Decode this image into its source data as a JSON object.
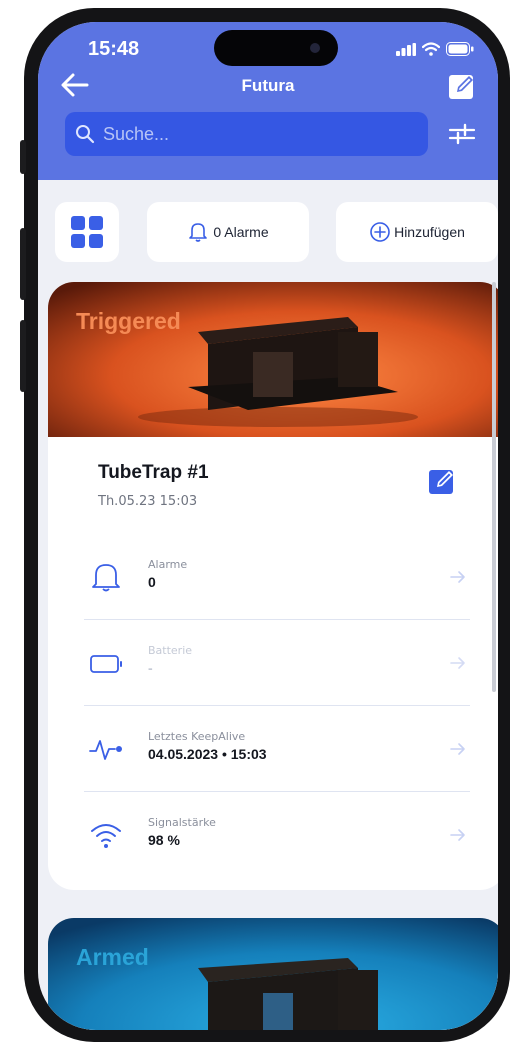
{
  "status": {
    "time": "15:48"
  },
  "header": {
    "title": "Futura"
  },
  "search": {
    "placeholder": "Suche..."
  },
  "toolbar": {
    "alarms_label": "0 Alarme",
    "add_label": "Hinzufügen"
  },
  "cards": [
    {
      "status_label": "Triggered",
      "status_color": "#e0622e",
      "name": "TubeTrap #1",
      "date": "Th.05.23 15:03",
      "rows": [
        {
          "icon": "bell-icon",
          "label": "Alarme",
          "value": "0"
        },
        {
          "icon": "battery-icon",
          "label": "Batterie",
          "value": "-"
        },
        {
          "icon": "activity-icon",
          "label": "Letztes KeepAlive",
          "value": "04.05.2023 • 15:03"
        },
        {
          "icon": "wifi-icon",
          "label": "Signalstärke",
          "value": "98 %"
        }
      ]
    },
    {
      "status_label": "Armed",
      "status_color": "#28a8dc"
    }
  ],
  "colors": {
    "header": "#5b74e2",
    "accent": "#3a5fe6",
    "background": "#eef0f6"
  }
}
